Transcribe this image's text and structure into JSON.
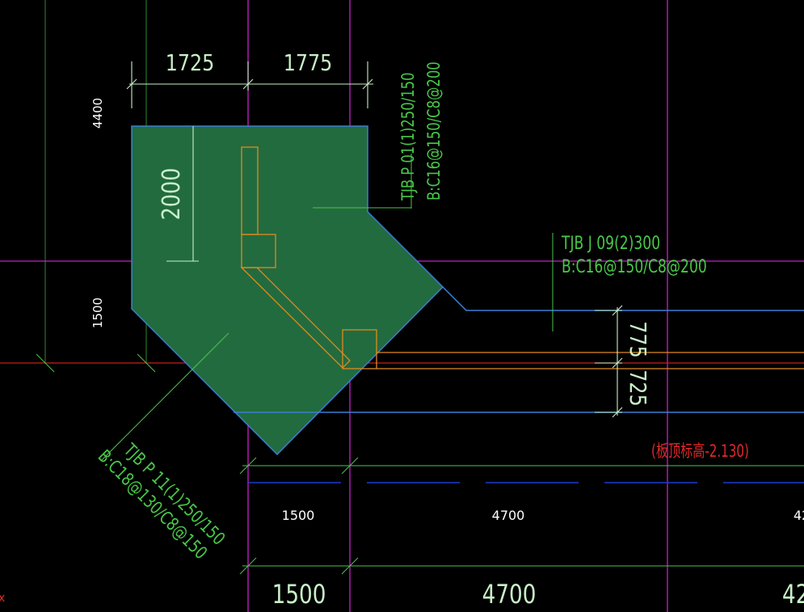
{
  "drawing": {
    "dims_top": [
      "1725",
      "1775"
    ],
    "dim_left_upper": "4400",
    "dim_left_lower": "1500",
    "dim_inner_vertical": "2000",
    "dims_right_vertical": [
      "775",
      "725"
    ],
    "callouts": {
      "upper_right": {
        "line1": "TJB P 01(1)250/150",
        "line2": "B:C16@150/C8@200"
      },
      "right": {
        "line1": "TJB J 09(2)300",
        "line2": "B:C16@150/C8@200"
      },
      "lower_left": {
        "line1": "TJB P 11(1)250/150",
        "line2": "B:C18@130/C8@150"
      }
    },
    "elevation_note": "(板顶标高-2.130)",
    "axis_dims_small": [
      "1500",
      "4700",
      "42"
    ],
    "axis_dims_large": [
      "1500",
      "4700",
      "42"
    ],
    "corner_mark": "x",
    "colors": {
      "background": "#000000",
      "slab_fill": "#226b3f",
      "slab_edge": "#3a7fd4",
      "dim_line": "#c8f0c8",
      "annotation": "#49c749",
      "axis_magenta": "#c81ec8",
      "axis_red": "#c81e1e",
      "beam_orange": "#e08a1e",
      "elevation_red": "#e02828"
    }
  }
}
